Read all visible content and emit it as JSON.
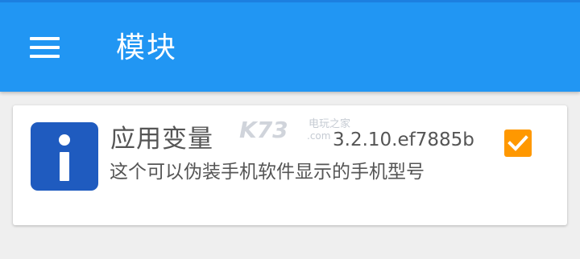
{
  "appbar": {
    "title": "模块",
    "menu_icon": "hamburger-menu-icon",
    "color": "#2196f3"
  },
  "module": {
    "icon": "info-icon",
    "icon_color": "#1f5bbf",
    "name": "应用变量",
    "version": "3.2.10.ef7885b",
    "description": "这个可以伪装手机软件显示的手机型号",
    "enabled": true,
    "checkbox_color": "#ff9800"
  },
  "watermark": {
    "logo": "K73",
    "text_cn": "电玩之家",
    "text_com": ".com"
  }
}
